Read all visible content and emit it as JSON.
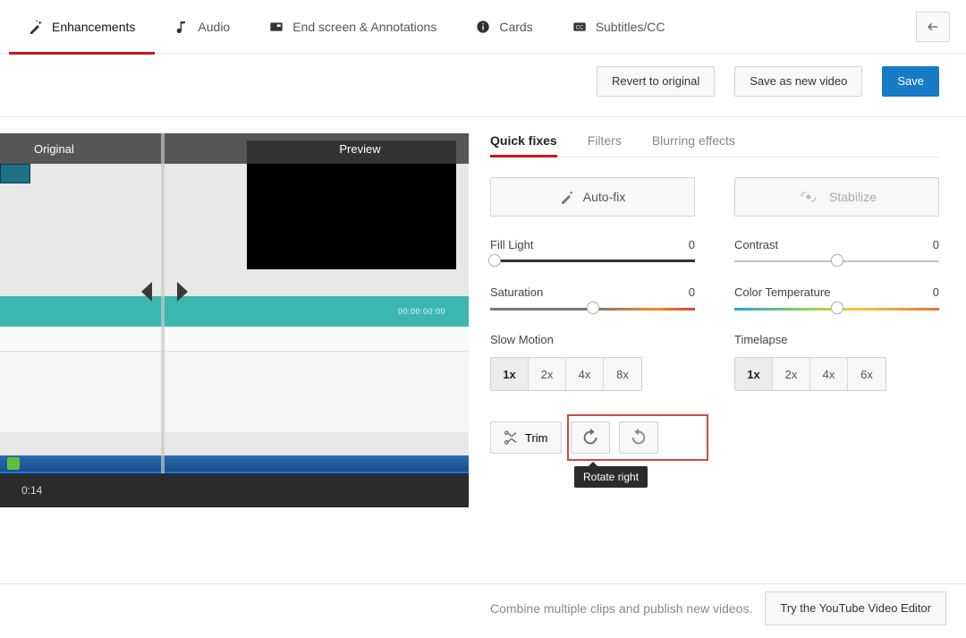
{
  "top_tabs": {
    "enhancements": "Enhancements",
    "audio": "Audio",
    "end_screen": "End screen & Annotations",
    "cards": "Cards",
    "subtitles": "Subtitles/CC"
  },
  "actions": {
    "revert": "Revert to original",
    "save_as_new": "Save as new video",
    "save": "Save"
  },
  "preview": {
    "original_label": "Original",
    "preview_label": "Preview",
    "timestamp": "0:14",
    "inner_time": "00:00:00:00"
  },
  "sub_tabs": {
    "quick_fixes": "Quick fixes",
    "filters": "Filters",
    "blurring": "Blurring effects"
  },
  "big_buttons": {
    "autofix": "Auto-fix",
    "stabilize": "Stabilize"
  },
  "sliders": {
    "fill_light": {
      "label": "Fill Light",
      "value": "0"
    },
    "contrast": {
      "label": "Contrast",
      "value": "0"
    },
    "saturation": {
      "label": "Saturation",
      "value": "0"
    },
    "color_temp": {
      "label": "Color Temperature",
      "value": "0"
    }
  },
  "speed": {
    "slow_label": "Slow Motion",
    "time_label": "Timelapse",
    "slow_opts": [
      "1x",
      "2x",
      "4x",
      "8x"
    ],
    "time_opts": [
      "1x",
      "2x",
      "4x",
      "6x"
    ]
  },
  "tools": {
    "trim": "Trim",
    "tooltip": "Rotate right"
  },
  "footer": {
    "hint": "Combine multiple clips and publish new videos.",
    "cta": "Try the YouTube Video Editor"
  }
}
